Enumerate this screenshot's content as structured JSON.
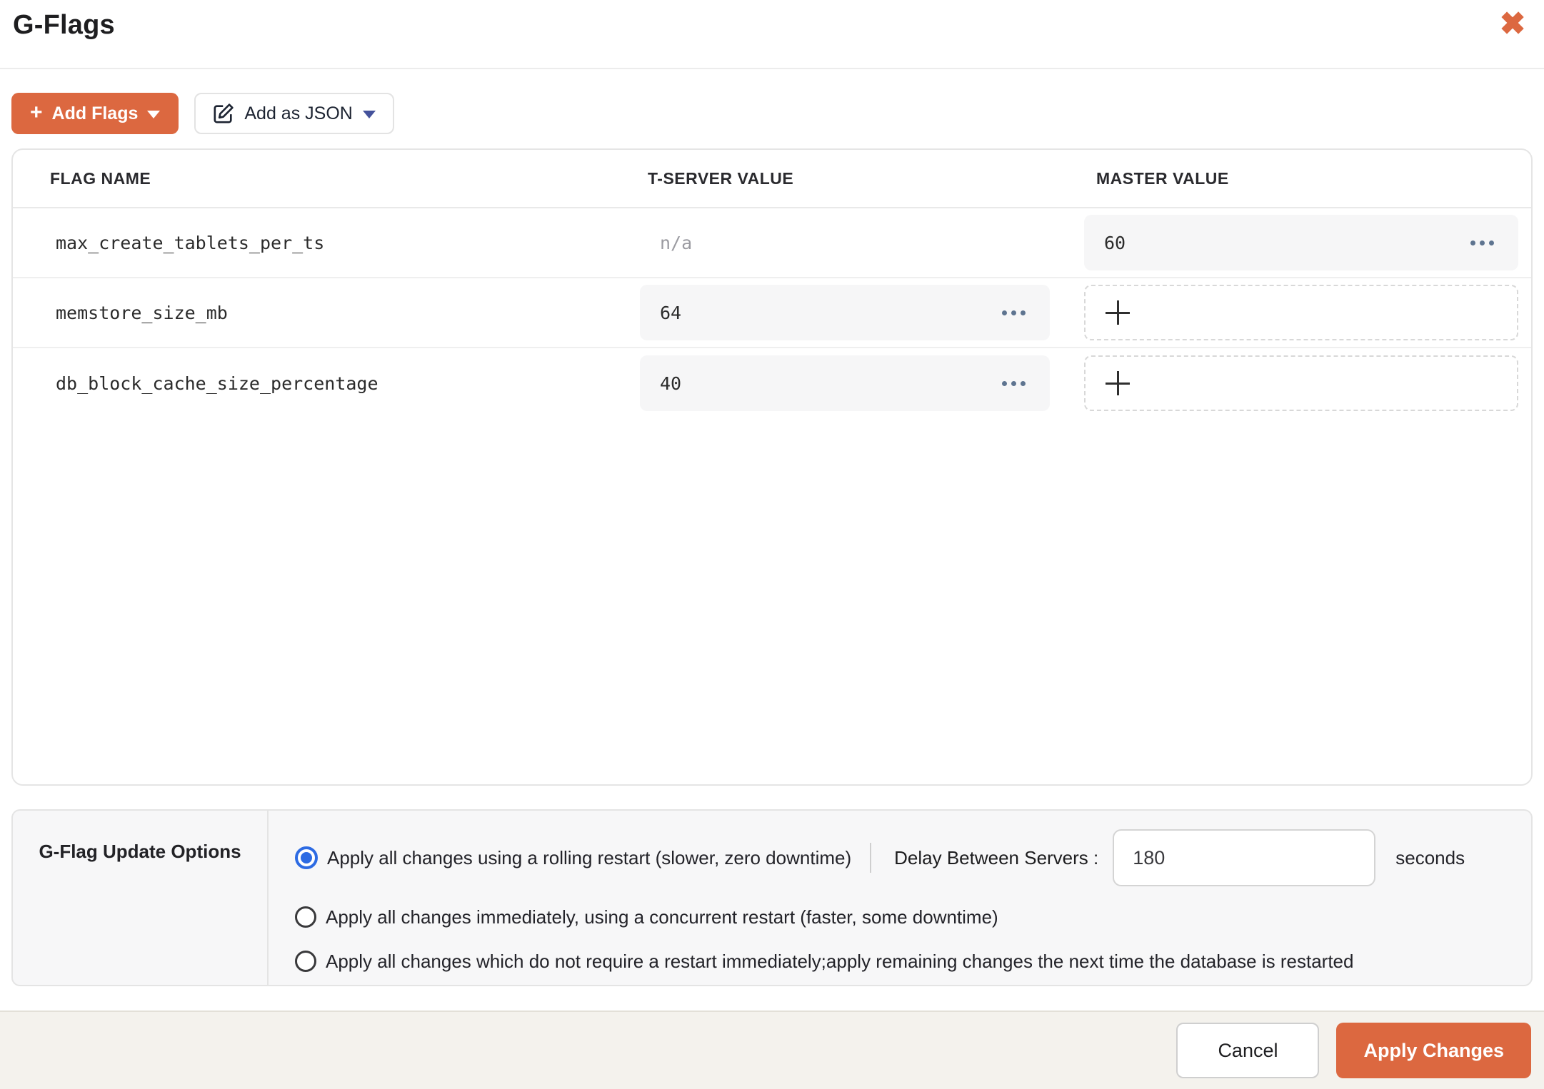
{
  "header": {
    "title": "G-Flags"
  },
  "toolbar": {
    "add_flags": "Add Flags",
    "add_as_json": "Add as JSON"
  },
  "table": {
    "col_flag": "FLAG NAME",
    "col_tserver": "T-SERVER VALUE",
    "col_master": "MASTER VALUE",
    "rows": [
      {
        "flag": "max_create_tablets_per_ts",
        "tserver": "n/a",
        "master": "60"
      },
      {
        "flag": "memstore_size_mb",
        "tserver": "64"
      },
      {
        "flag": "db_block_cache_size_percentage",
        "tserver": "40"
      }
    ]
  },
  "options": {
    "title": "G-Flag Update Options",
    "radio_rolling": "Apply all changes using a rolling restart (slower, zero downtime)",
    "radio_concurrent": "Apply all changes immediately, using a concurrent restart (faster, some downtime)",
    "radio_no_restart": "Apply all changes which do not require a restart immediately;apply remaining changes the next time the database is restarted",
    "delay_label": "Delay Between Servers :",
    "delay_value": "180",
    "delay_unit": "seconds"
  },
  "footer": {
    "cancel": "Cancel",
    "apply": "Apply Changes"
  },
  "colors": {
    "accent_orange": "#DC6840",
    "radio_selected_blue": "#2D6BE3"
  }
}
